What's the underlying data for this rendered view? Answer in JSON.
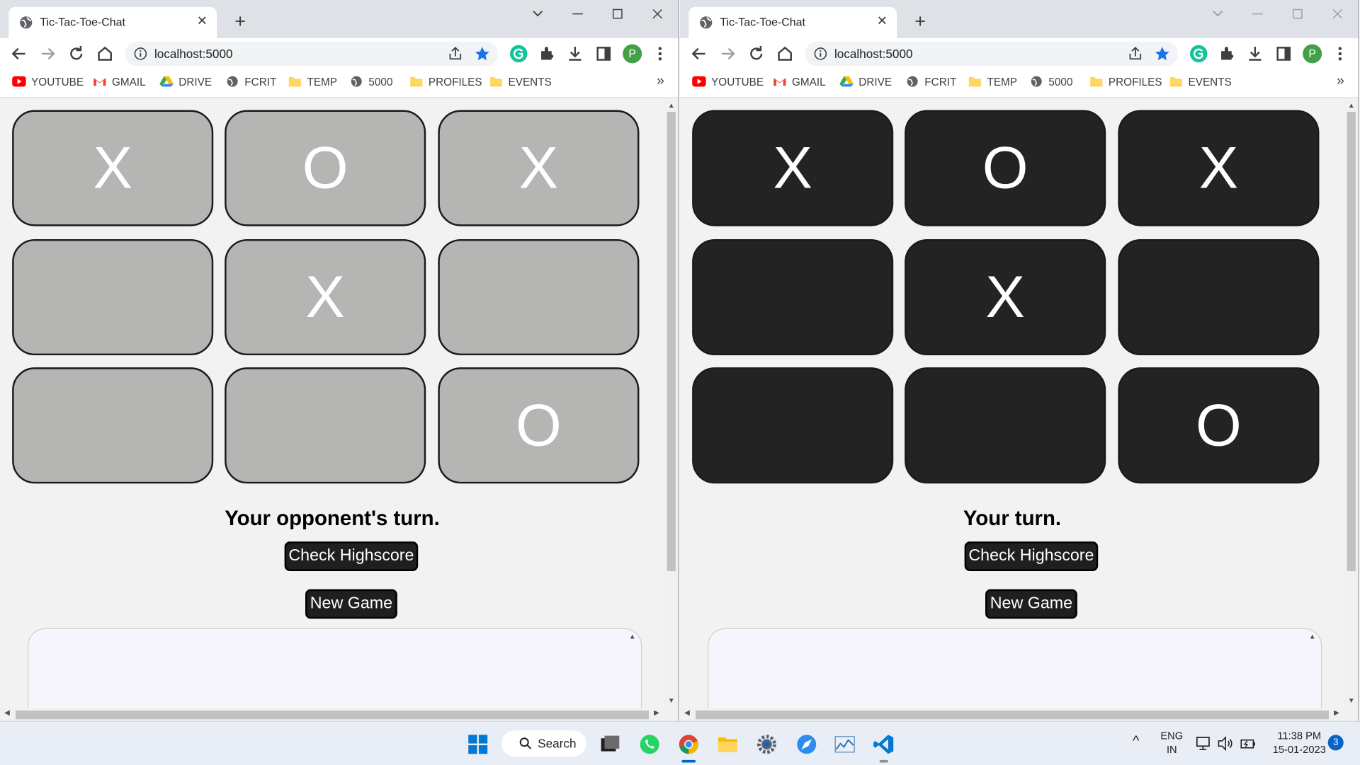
{
  "browser": {
    "tab_title": "Tic-Tac-Toe-Chat",
    "tab_close": "✕",
    "new_tab": "+",
    "url": "localhost:5000",
    "avatar_letter": "P",
    "bookmarks": [
      "YOUTUBE",
      "GMAIL",
      "DRIVE",
      "FCRIT",
      "TEMP",
      "5000",
      "PROFILES",
      "EVENTS"
    ],
    "bookmarks_more": "»"
  },
  "left": {
    "board": [
      "X",
      "O",
      "X",
      "",
      "X",
      "",
      "",
      "",
      "O"
    ],
    "status": "Your opponent's turn.",
    "highscore_label": "Check Highscore",
    "newgame_label": "New Game"
  },
  "right": {
    "board": [
      "X",
      "O",
      "X",
      "",
      "X",
      "",
      "",
      "",
      "O"
    ],
    "status": "Your turn.",
    "highscore_label": "Check Highscore",
    "newgame_label": "New Game"
  },
  "taskbar": {
    "search_label": "Search",
    "lang_top": "ENG",
    "lang_bottom": "IN",
    "time": "11:38 PM",
    "date": "15-01-2023",
    "notifications": "3",
    "overflow": "^"
  },
  "colors": {
    "light_cell": "#b5b5b4",
    "dark_cell": "#232323",
    "button_bg": "#1f1f1f",
    "page_bg": "#f2f2f2"
  }
}
